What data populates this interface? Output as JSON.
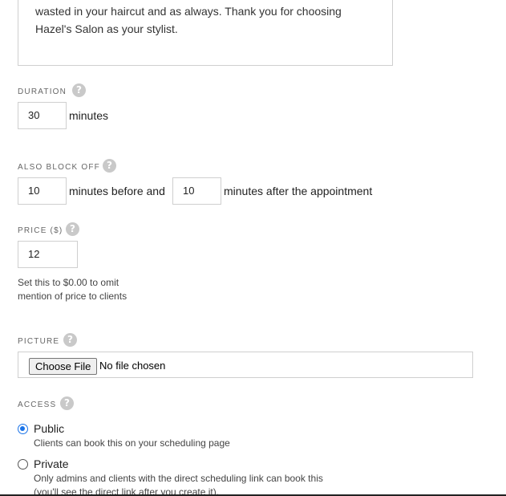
{
  "description": {
    "line1": "wasted in your haircut and as always. Thank you for choosing",
    "line2": "Hazel's Salon as your stylist."
  },
  "duration": {
    "label": "DURATION",
    "value": "30",
    "unit": "minutes"
  },
  "block_off": {
    "label": "ALSO BLOCK OFF",
    "before_value": "10",
    "before_text": "minutes before and",
    "after_value": "10",
    "after_text": "minutes after the appointment"
  },
  "price": {
    "label": "PRICE ($)",
    "value": "12",
    "hint_line1": "Set this to $0.00 to omit",
    "hint_line2": "mention of price to clients"
  },
  "picture": {
    "label": "PICTURE",
    "button_label": "Choose File",
    "status": "No file chosen"
  },
  "access": {
    "label": "ACCESS",
    "options": [
      {
        "label": "Public",
        "description": "Clients can book this on your scheduling page",
        "checked": true
      },
      {
        "label": "Private",
        "description": "Only admins and clients with the direct scheduling link can book this",
        "description2": "(you'll see the direct link after you create it).",
        "checked": false
      }
    ]
  },
  "help_icon": "question-mark",
  "colors": {
    "border": "#cfcfcf",
    "label": "#666666",
    "help_bg": "#c9c9c9",
    "radio_accent": "#1a73e8"
  }
}
